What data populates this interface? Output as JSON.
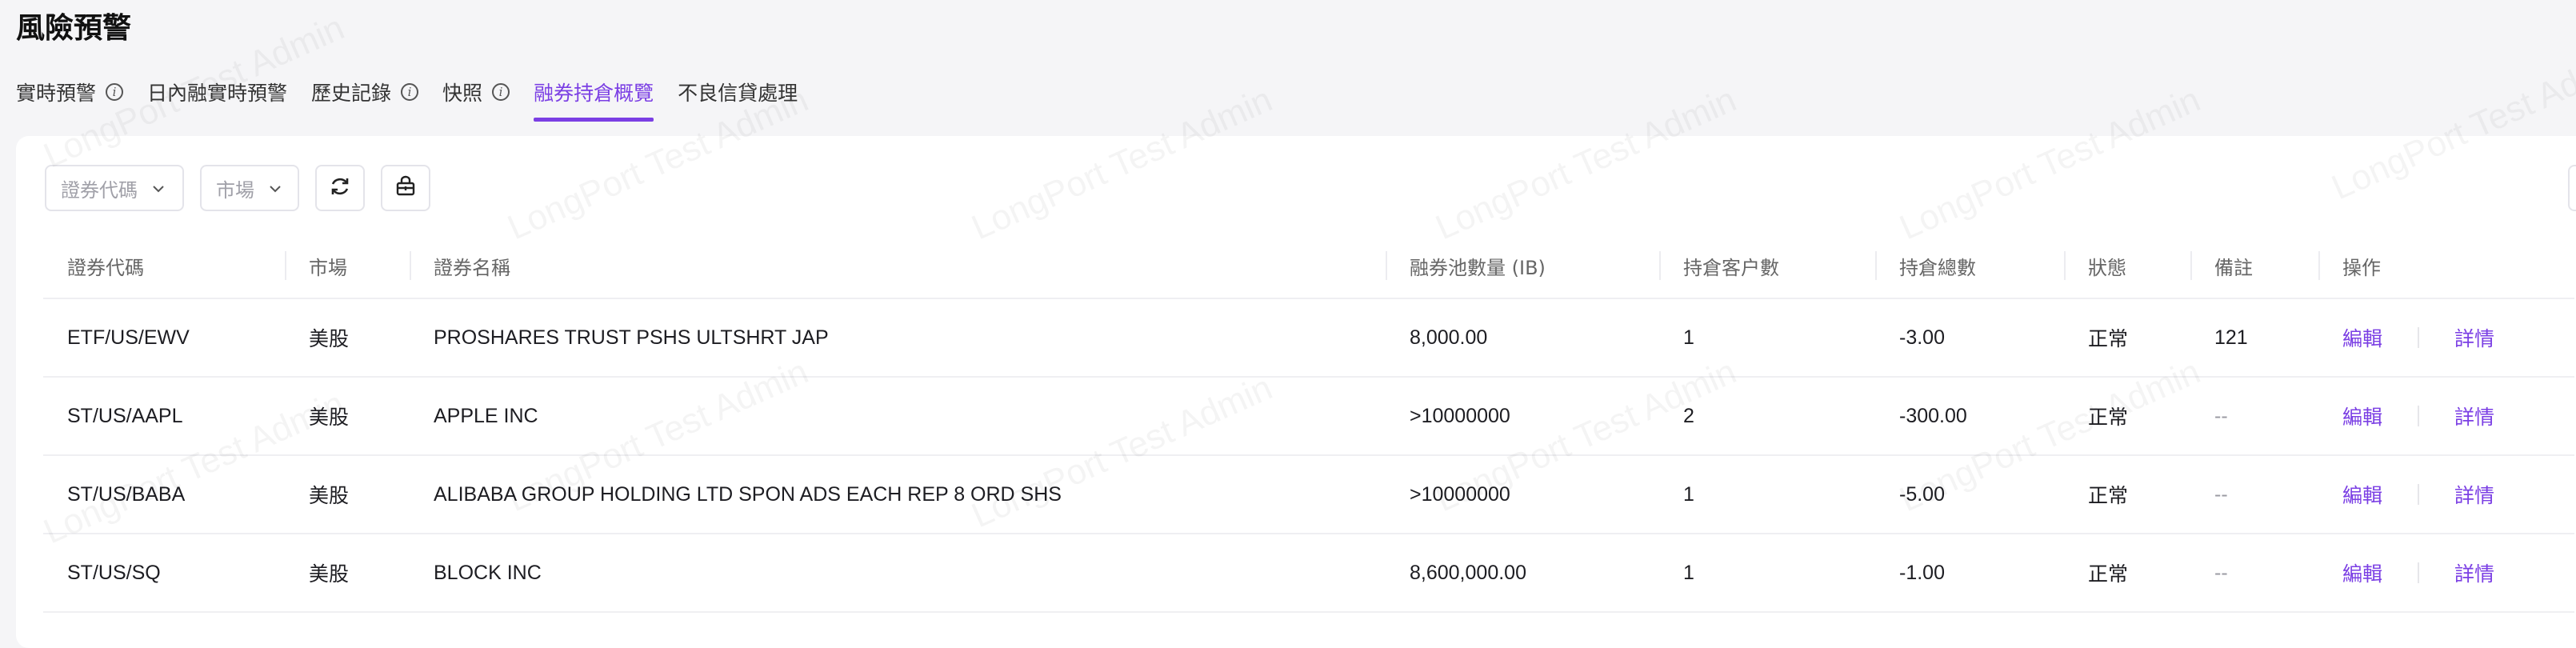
{
  "page": {
    "title": "風險預警"
  },
  "tabs": [
    {
      "label": "實時預警",
      "info": true
    },
    {
      "label": "日內融實時預警",
      "info": false
    },
    {
      "label": "歷史記錄",
      "info": true
    },
    {
      "label": "快照",
      "info": true
    },
    {
      "label": "融券持倉概覽",
      "info": false,
      "active": true
    },
    {
      "label": "不良信貸處理",
      "info": false
    }
  ],
  "filters": {
    "code_placeholder": "證券代碼",
    "market_placeholder": "市場"
  },
  "toolbar": {
    "refresh_icon": "refresh-icon",
    "export_icon": "basket-icon"
  },
  "table": {
    "columns": [
      "證券代碼",
      "市場",
      "證券名稱",
      "融券池數量 (IB)",
      "持倉客户數",
      "持倉總數",
      "狀態",
      "備註",
      "操作"
    ],
    "rows": [
      {
        "code": "ETF/US/EWV",
        "market": "美股",
        "name": "PROSHARES TRUST PSHS ULTSHRT JAP",
        "pool": "8,000.00",
        "clients": "1",
        "total": "-3.00",
        "status": "正常",
        "remark": "121",
        "edit": "編輯",
        "detail": "詳情"
      },
      {
        "code": "ST/US/AAPL",
        "market": "美股",
        "name": "APPLE INC",
        "pool": ">10000000",
        "clients": "2",
        "total": "-300.00",
        "status": "正常",
        "remark": "--",
        "edit": "編輯",
        "detail": "詳情"
      },
      {
        "code": "ST/US/BABA",
        "market": "美股",
        "name": "ALIBABA GROUP HOLDING LTD SPON ADS EACH REP 8 ORD SHS",
        "pool": ">10000000",
        "clients": "1",
        "total": "-5.00",
        "status": "正常",
        "remark": "--",
        "edit": "編輯",
        "detail": "詳情"
      },
      {
        "code": "ST/US/SQ",
        "market": "美股",
        "name": "BLOCK INC",
        "pool": "8,600,000.00",
        "clients": "1",
        "total": "-1.00",
        "status": "正常",
        "remark": "--",
        "edit": "編輯",
        "detail": "詳情"
      }
    ]
  },
  "watermark": "LongPort Test Admin",
  "colors": {
    "accent": "#7b3fe4",
    "background": "#f5f5f7"
  }
}
